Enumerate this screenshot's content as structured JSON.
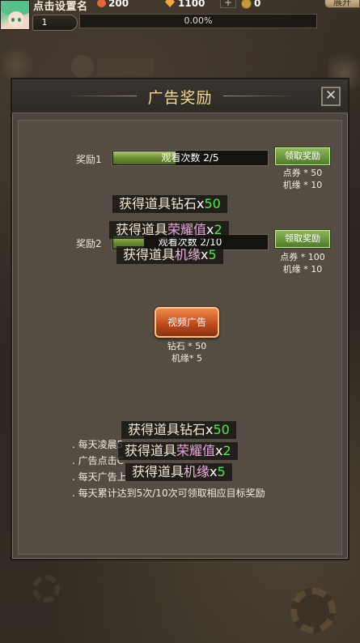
{
  "hud": {
    "player_name": "点击设置名",
    "heart_value": "200",
    "diamond_value": "1100",
    "plus_label": "+",
    "coin_value": "0",
    "expand_label": "展开",
    "level": "1",
    "exp_percent": "0.00%"
  },
  "dialog": {
    "title": "广告奖励",
    "close_label": "✕",
    "rewards": [
      {
        "label": "奖励1",
        "progress_text": "观看次数 2/5",
        "progress_fraction": 0.4,
        "claim_label": "领取奖励",
        "desc_line1": "点券 * 50",
        "desc_line2": "机缘 * 10"
      },
      {
        "label": "奖励2",
        "progress_text": "观看次数 2/10",
        "progress_fraction": 0.2,
        "claim_label": "领取奖励",
        "desc_line1": "点券 * 100",
        "desc_line2": "机缘 * 10"
      }
    ],
    "video_button": "视频广告",
    "video_desc_line1": "钻石 * 50",
    "video_desc_line2": "机缘* 5",
    "rules": [
      ". 每天凌晨5",
      ". 广告点击C",
      ". 每天广告上",
      ". 每天累计达到5次/10次可领取相应目标奖励"
    ]
  },
  "toasts": [
    {
      "prefix": "获得道具",
      "item": "钻石",
      "x": "x",
      "num": "50",
      "kind": "diamond"
    },
    {
      "prefix": "获得道具",
      "item": "荣耀值",
      "x": "x",
      "num": "2",
      "kind": "honor"
    },
    {
      "prefix": "获得道具",
      "item": "机缘",
      "x": "x",
      "num": "5",
      "kind": "fate"
    }
  ],
  "colors": {
    "accent_title": "#f7d98f",
    "toast_number": "#54e84a",
    "claim_button": "#6c9a3c",
    "video_button": "#c4531f"
  }
}
